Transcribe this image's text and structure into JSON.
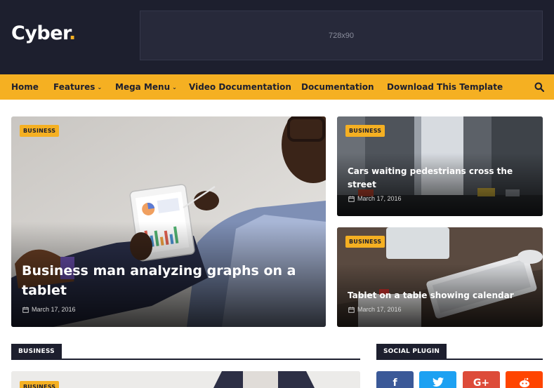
{
  "header": {
    "logo_text": "Cyber",
    "logo_dot": ".",
    "ad_text": "728x90"
  },
  "nav": {
    "items": [
      {
        "label": "Home",
        "dropdown": false
      },
      {
        "label": "Features",
        "dropdown": true
      },
      {
        "label": "Mega Menu",
        "dropdown": true
      },
      {
        "label": "Video Documentation",
        "dropdown": false
      },
      {
        "label": "Documentation",
        "dropdown": false
      },
      {
        "label": "Download This Template",
        "dropdown": false
      }
    ],
    "caret": "⌄",
    "search_icon": "search-icon"
  },
  "featured": {
    "main": {
      "category": "BUSINESS",
      "title": "Business man analyzing graphs on a tablet",
      "date": "March 17, 2016"
    },
    "side": [
      {
        "category": "BUSINESS",
        "title": "Cars waiting pedestrians cross the street",
        "date": "March 17, 2016"
      },
      {
        "category": "BUSINESS",
        "title": "Tablet on a table showing calendar",
        "date": "March 17, 2016"
      }
    ]
  },
  "sections": {
    "business": {
      "label": "BUSINESS",
      "first_post_category": "BUSINESS"
    },
    "social": {
      "label": "SOCIAL PLUGIN"
    }
  },
  "social_buttons": [
    {
      "icon": "facebook-icon",
      "glyph": "f",
      "color": "#3b5998"
    },
    {
      "icon": "twitter-icon",
      "glyph": "🐦",
      "color": "#1da1f2"
    },
    {
      "icon": "google-plus-icon",
      "glyph": "G+",
      "color": "#dd4b39"
    },
    {
      "icon": "reddit-icon",
      "glyph": "◉",
      "color": "#ff4500"
    }
  ],
  "colors": {
    "accent": "#f5b022",
    "dark": "#1d1f2e"
  }
}
